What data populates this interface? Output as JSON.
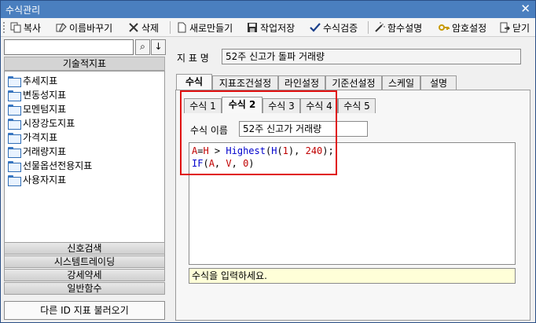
{
  "window": {
    "title": "수식관리",
    "close_label": "✕"
  },
  "toolbar": {
    "items": [
      {
        "label": "복사"
      },
      {
        "label": "이름바꾸기"
      },
      {
        "label": "삭제"
      },
      {
        "label": "새로만들기"
      },
      {
        "label": "작업저장"
      },
      {
        "label": "수식검증"
      },
      {
        "label": "함수설명"
      },
      {
        "label": "암호설정"
      },
      {
        "label": "닫기"
      }
    ]
  },
  "left": {
    "search": {
      "value": "",
      "placeholder": ""
    },
    "search_icon": "⌕",
    "down_icon": "↓",
    "section_header": "기술적지표",
    "tree_items": [
      {
        "label": "추세지표"
      },
      {
        "label": "변동성지표"
      },
      {
        "label": "모멘텀지표"
      },
      {
        "label": "시장강도지표"
      },
      {
        "label": "가격지표"
      },
      {
        "label": "거래량지표"
      },
      {
        "label": "선물옵션전용지표"
      },
      {
        "label": "사용자지표"
      }
    ],
    "categories": [
      {
        "label": "신호검색"
      },
      {
        "label": "시스템트레이딩"
      },
      {
        "label": "강세약세"
      },
      {
        "label": "일반함수"
      }
    ],
    "bottom_button": "다른 ID 지표 불러오기"
  },
  "right": {
    "indicator_label": "지 표 명",
    "indicator_name": "52주 신고가 돌파 거래량",
    "main_tabs": [
      {
        "label": "수식"
      },
      {
        "label": "지표조건설정"
      },
      {
        "label": "라인설정"
      },
      {
        "label": "기준선설정"
      },
      {
        "label": "스케일"
      },
      {
        "label": "설명"
      }
    ],
    "formula_tabs": [
      {
        "label": "수식 1"
      },
      {
        "label": "수식 2"
      },
      {
        "label": "수식 3"
      },
      {
        "label": "수식 4"
      },
      {
        "label": "수식 5"
      }
    ],
    "formula_name_label": "수식 이름",
    "formula_name_value": "52주 신고가 거래량",
    "code": {
      "line1": {
        "var": "A",
        "op1": "=",
        "var2": "H",
        "op2": " > ",
        "fn": "Highest",
        "p1": "(",
        "fn2": "H",
        "p2": "(",
        "num1": "1",
        "p3": "), ",
        "num2": "240",
        "p4": ");"
      },
      "line2": {
        "fn": "IF",
        "p1": "(",
        "a": "A",
        "c1": ", ",
        "b": "V",
        "c2": ", ",
        "n": "0",
        "p2": ")"
      }
    },
    "hint": "수식을 입력하세요."
  },
  "colors": {
    "titlebar": "#4a7fbf",
    "highlight": "#e01010",
    "hint_bg": "#ffffd8"
  }
}
